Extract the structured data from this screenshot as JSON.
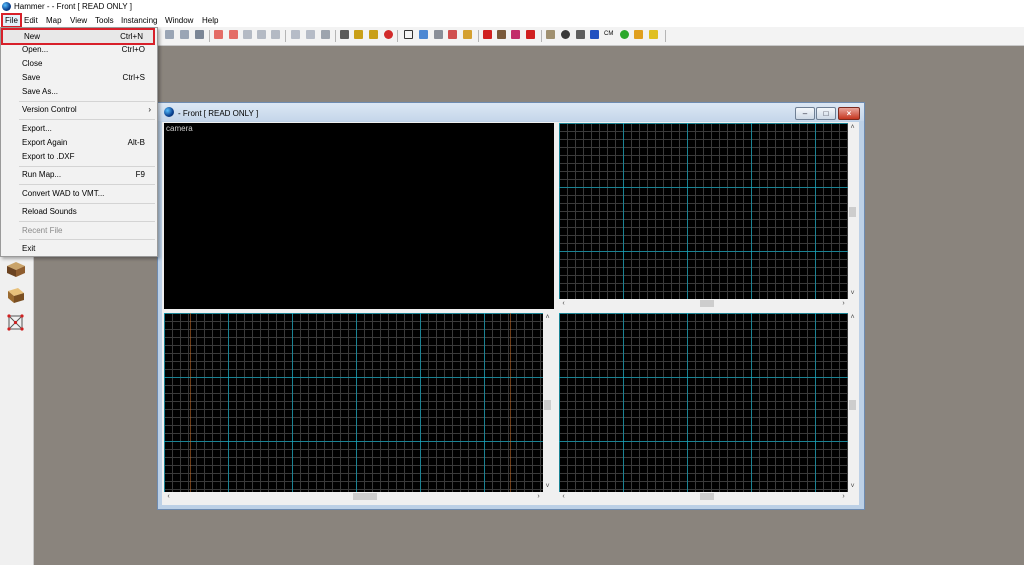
{
  "window": {
    "title": "Hammer - - Front [ READ ONLY ]"
  },
  "menubar": {
    "items": [
      "File",
      "Edit",
      "Map",
      "View",
      "Tools",
      "Instancing",
      "Window",
      "Help"
    ]
  },
  "file_menu": {
    "items": [
      {
        "label": "New",
        "shortcut": "Ctrl+N",
        "highlighted": true
      },
      {
        "label": "Open...",
        "shortcut": "Ctrl+O"
      },
      {
        "label": "Close",
        "shortcut": ""
      },
      {
        "label": "Save",
        "shortcut": "Ctrl+S"
      },
      {
        "label": "Save As...",
        "shortcut": ""
      },
      {
        "label": "Version Control",
        "shortcut": "›"
      },
      {
        "label": "Export...",
        "shortcut": ""
      },
      {
        "label": "Export Again",
        "shortcut": "Alt-B"
      },
      {
        "label": "Export to .DXF",
        "shortcut": ""
      },
      {
        "label": "Run Map...",
        "shortcut": "F9"
      },
      {
        "label": "Convert WAD to VMT...",
        "shortcut": ""
      },
      {
        "label": "Reload Sounds",
        "shortcut": ""
      },
      {
        "label": "Recent File",
        "shortcut": "",
        "disabled": true
      },
      {
        "label": "Exit",
        "shortcut": ""
      }
    ]
  },
  "toolbar": {
    "cm_label": "CM"
  },
  "child_window": {
    "title": "- Front [ READ ONLY ]",
    "viewports": {
      "camera_label": "camera"
    }
  },
  "colors": {
    "accent": "#d8202a",
    "background": "#8a847d",
    "grid": "#00bedc"
  }
}
